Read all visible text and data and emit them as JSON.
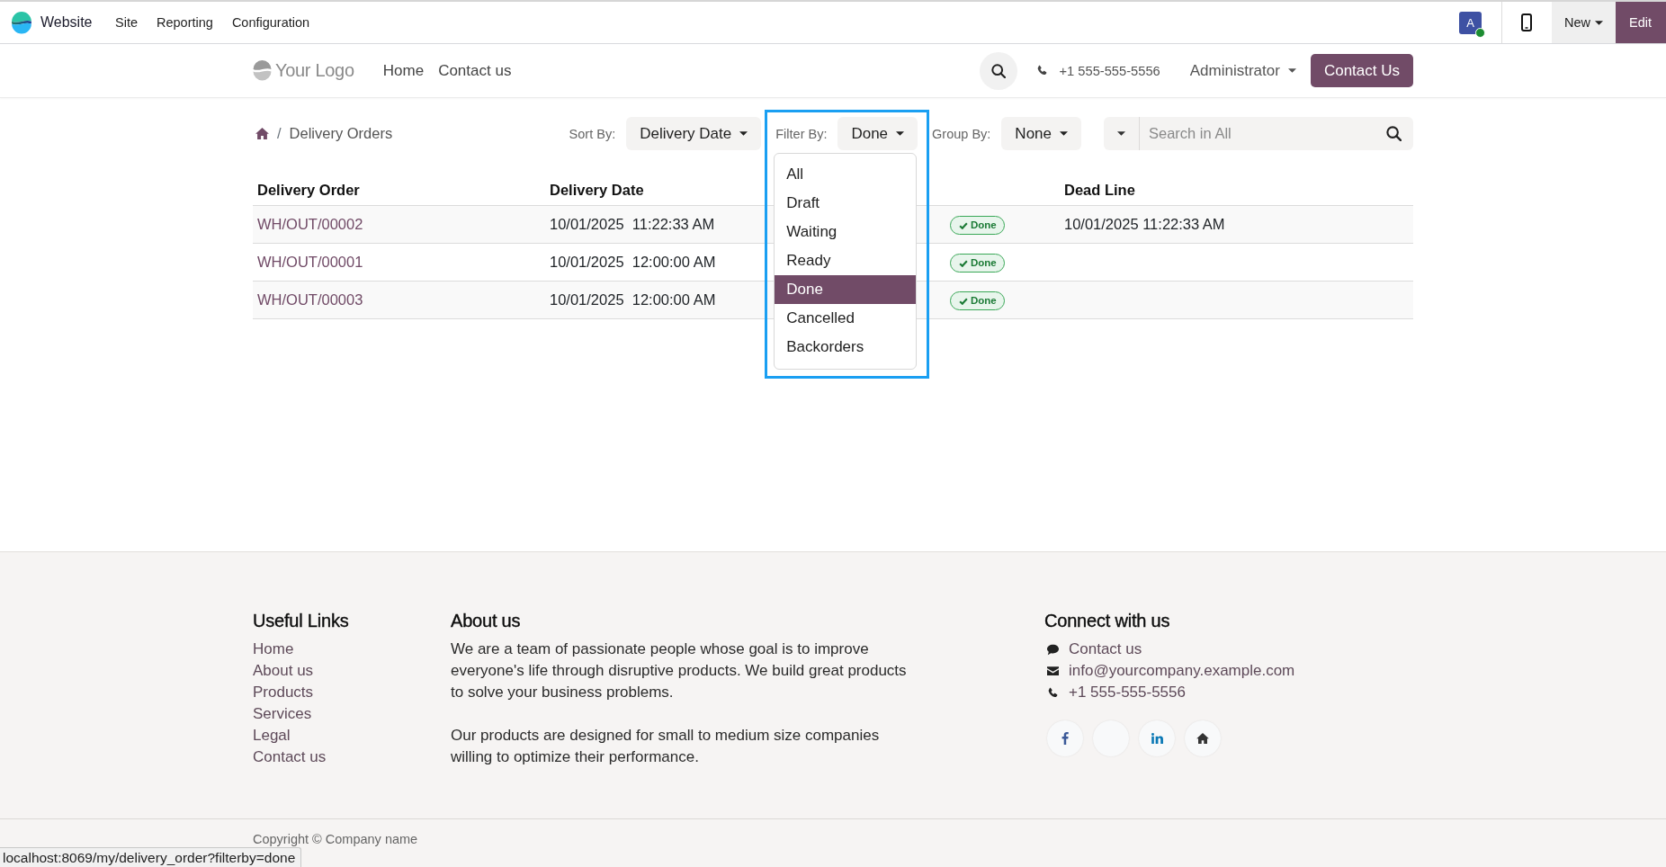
{
  "top_bar": {
    "app_name": "Website",
    "menu": [
      "Site",
      "Reporting",
      "Configuration"
    ],
    "avatar": {
      "initial": "A",
      "online": true
    },
    "new_button": "New",
    "edit_button": "Edit"
  },
  "site_header": {
    "logo": "Your Logo",
    "nav": [
      "Home",
      "Contact us"
    ],
    "phone": "+1 555-555-5556",
    "user_menu": "Administrator",
    "cta_button": "Contact Us"
  },
  "breadcrumb": {
    "separator": "/",
    "current": "Delivery Orders"
  },
  "controls": {
    "sort": {
      "label": "Sort By:",
      "value": "Delivery Date"
    },
    "filter": {
      "label": "Filter By:",
      "value": "Done",
      "highlighted": true,
      "expanded": true,
      "options": [
        {
          "label": "All",
          "selected": false
        },
        {
          "label": "Draft",
          "selected": false
        },
        {
          "label": "Waiting",
          "selected": false
        },
        {
          "label": "Ready",
          "selected": false
        },
        {
          "label": "Done",
          "selected": true
        },
        {
          "label": "Cancelled",
          "selected": false
        },
        {
          "label": "Backorders",
          "selected": false
        }
      ]
    },
    "group": {
      "label": "Group By:",
      "value": "None"
    },
    "search": {
      "placeholder": "Search in All"
    }
  },
  "table": {
    "columns": [
      {
        "label": "Delivery Order",
        "kind": "link"
      },
      {
        "label": "Delivery Date",
        "kind": "text"
      },
      {
        "kind": "badge"
      },
      {
        "label": "Dead Line",
        "kind": "text"
      }
    ],
    "rows": [
      {
        "cells": [
          "WH/OUT/00002",
          "10/01/2025  11:22:33 AM",
          "Done",
          "10/01/2025 11:22:33 AM"
        ]
      },
      {
        "cells": [
          "WH/OUT/00001",
          "10/01/2025  12:00:00 AM",
          "Done"
        ]
      },
      {
        "cells": [
          "WH/OUT/00003",
          "10/01/2025  12:00:00 AM",
          "Done"
        ]
      }
    ]
  },
  "footer": {
    "useful_links": {
      "title": "Useful Links",
      "links": [
        "Home",
        "About us",
        "Products",
        "Services",
        "Legal",
        "Contact us"
      ]
    },
    "about": {
      "title": "About us",
      "paragraphs": [
        "We are a team of passionate people whose goal is to improve everyone's life through disruptive products. We build great products to solve your business problems.",
        "Our products are designed for small to medium size companies willing to optimize their performance."
      ]
    },
    "connect": {
      "title": "Connect with us",
      "items": [
        {
          "kind": "chat",
          "text": "Contact us"
        },
        {
          "kind": "email",
          "text": "info@yourcompany.example.com"
        },
        {
          "kind": "phone",
          "text": "+1 555-555-5556"
        }
      ]
    }
  },
  "copyright": "Copyright © Company name",
  "status_url": "localhost:8069/my/delivery_order?filterby=done"
}
